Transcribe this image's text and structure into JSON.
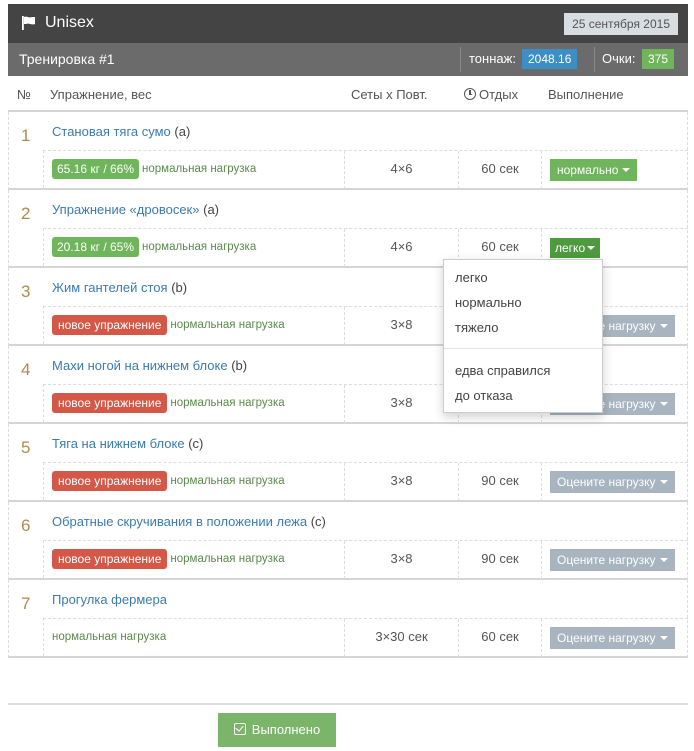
{
  "header": {
    "title": "Unisex",
    "date": "25 сентября 2015"
  },
  "workout": {
    "name": "Тренировка #1",
    "tonnage_label": "тоннаж:",
    "tonnage_value": "2048.16",
    "points_label": "Очки:",
    "points_value": "375"
  },
  "table_headers": {
    "num": "№",
    "exercise": "Упражнение, вес",
    "sets": "Сеты х Повт.",
    "rest": "Отдых",
    "status": "Выполнение"
  },
  "exercises": [
    {
      "num": "1",
      "name": "Становая тяга сумо",
      "group": "(a)",
      "weight": "65.16 кг / 66%",
      "badge": "",
      "load": "нормальная нагрузка",
      "sets": "4×6",
      "rest": "60 сек",
      "rating": "нормально"
    },
    {
      "num": "2",
      "name": "Упражнение «дровосек»",
      "group": "(a)",
      "weight": "20.18 кг / 65%",
      "badge": "",
      "load": "нормальная нагрузка",
      "sets": "4×6",
      "rest": "60 сек",
      "rating": "легко"
    },
    {
      "num": "3",
      "name": "Жим гантелей стоя",
      "group": "(b)",
      "weight": "",
      "badge": "новое упражнение",
      "load": "нормальная нагрузка",
      "sets": "3×8",
      "rest": "",
      "rating": "Оцените нагрузку"
    },
    {
      "num": "4",
      "name": "Махи ногой на нижнем блоке",
      "group": "(b)",
      "weight": "",
      "badge": "новое упражнение",
      "load": "нормальная нагрузка",
      "sets": "3×8",
      "rest": "",
      "rating": "Оцените нагрузку"
    },
    {
      "num": "5",
      "name": "Тяга на нижнем блоке",
      "group": "(c)",
      "weight": "",
      "badge": "новое упражнение",
      "load": "нормальная нагрузка",
      "sets": "3×8",
      "rest": "90 сек",
      "rating": "Оцените нагрузку"
    },
    {
      "num": "6",
      "name": "Обратные скручивания в положении лежа",
      "group": "(c)",
      "weight": "",
      "badge": "новое упражнение",
      "load": "нормальная нагрузка",
      "sets": "3×8",
      "rest": "90 сек",
      "rating": "Оцените нагрузку"
    },
    {
      "num": "7",
      "name": "Прогулка фермера",
      "group": "",
      "weight": "",
      "badge": "",
      "load": "нормальная нагрузка",
      "sets": "3×30 сек",
      "rest": "60 сек",
      "rating": "Оцените нагрузку"
    }
  ],
  "dropdown": {
    "items": [
      "легко",
      "нормально",
      "тяжело",
      "едва справился",
      "до отказа"
    ]
  },
  "done_button": "Выполнено",
  "colors": {
    "topbar": "#444444",
    "subbar": "#6b6b6b",
    "tonnage_badge": "#3b8fc4",
    "points_badge": "#6fb55c",
    "weight_badge": "#6fb55c",
    "new_badge": "#d35848",
    "rated_button": "#6fb55c",
    "unrated_button": "#a8b4bf",
    "done_button": "#7bb56a",
    "link": "#3a7bb0",
    "number": "#b08a50"
  }
}
